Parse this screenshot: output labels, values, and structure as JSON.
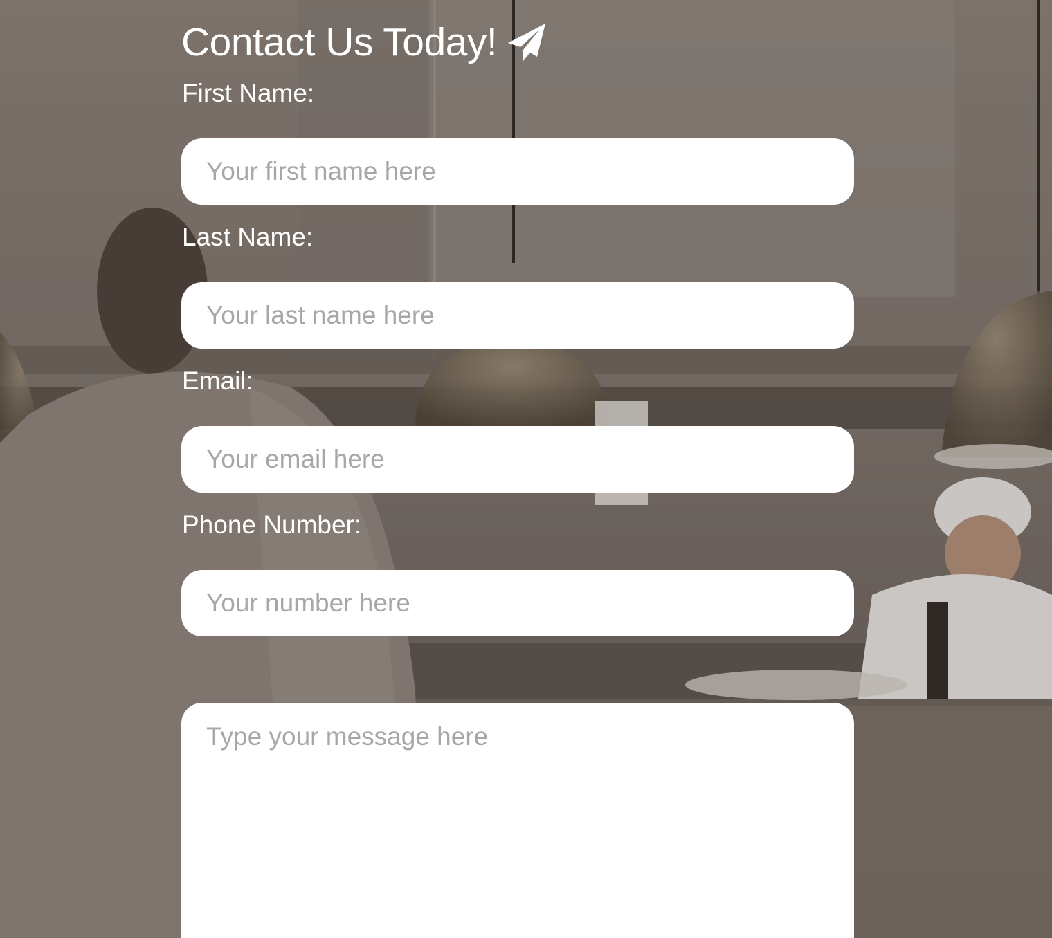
{
  "heading": {
    "title": "Contact Us Today!",
    "icon": "paper-plane-icon"
  },
  "fields": {
    "first_name": {
      "label": "First Name:",
      "placeholder": "Your first name here"
    },
    "last_name": {
      "label": "Last Name:",
      "placeholder": "Your last name here"
    },
    "email": {
      "label": "Email:",
      "placeholder": "Your email here"
    },
    "phone": {
      "label": "Phone Number:",
      "placeholder": "Your number here"
    },
    "message": {
      "placeholder": "Type your message here"
    }
  },
  "colors": {
    "text": "#ffffff",
    "input_background": "#ffffff",
    "placeholder": "#a7a7a7",
    "backdrop_tint": "#6b6460"
  }
}
